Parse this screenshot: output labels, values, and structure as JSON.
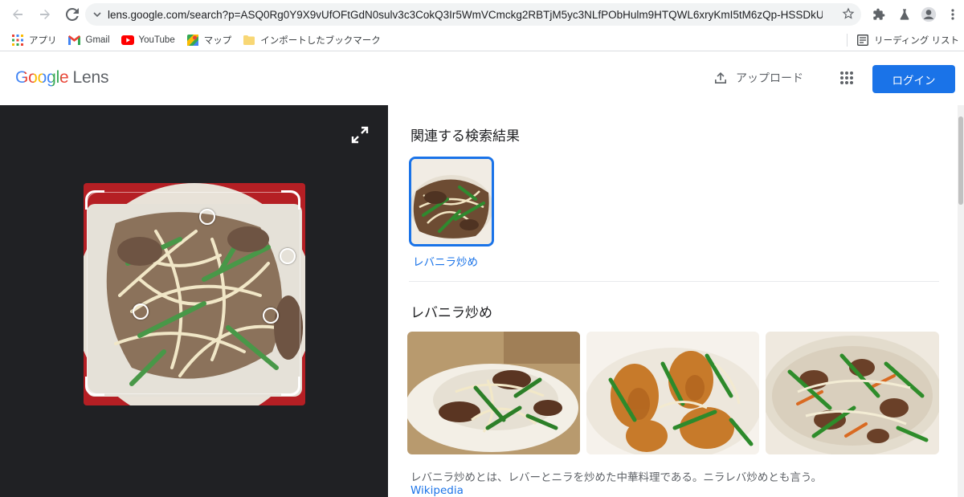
{
  "browser": {
    "url": "lens.google.com/search?p=ASQ0Rg0Y9X9vUfOFtGdN0sulv3c3CokQ3Ir5WmVCmckg2RBTjM5yc3NLfPObHulm9HTQWL6xryKmI5tM6zQp-HSSDkUM...",
    "bookmarks": [
      {
        "label": "アプリ",
        "icon": "apps-grid-icon"
      },
      {
        "label": "Gmail",
        "icon": "gmail-icon"
      },
      {
        "label": "YouTube",
        "icon": "youtube-icon"
      },
      {
        "label": "マップ",
        "icon": "maps-icon"
      },
      {
        "label": "インポートしたブックマーク",
        "icon": "folder-icon"
      }
    ],
    "reading_list": "リーディング リスト"
  },
  "header": {
    "logo_google": "Google",
    "logo_lens": "Lens",
    "upload_label": "アップロード",
    "login_label": "ログイン"
  },
  "results": {
    "related_heading": "関連する検索結果",
    "related_items": [
      {
        "label": "レバニラ炒め"
      }
    ],
    "topic_heading": "レバニラ炒め",
    "topic_description": "レバニラ炒めとは、レバーとニラを炒めた中華料理である。ニラレバ炒めとも言う。",
    "source_label": "Wikipedia"
  },
  "colors": {
    "accent": "#1a73e8",
    "panel_dark": "#202124"
  }
}
